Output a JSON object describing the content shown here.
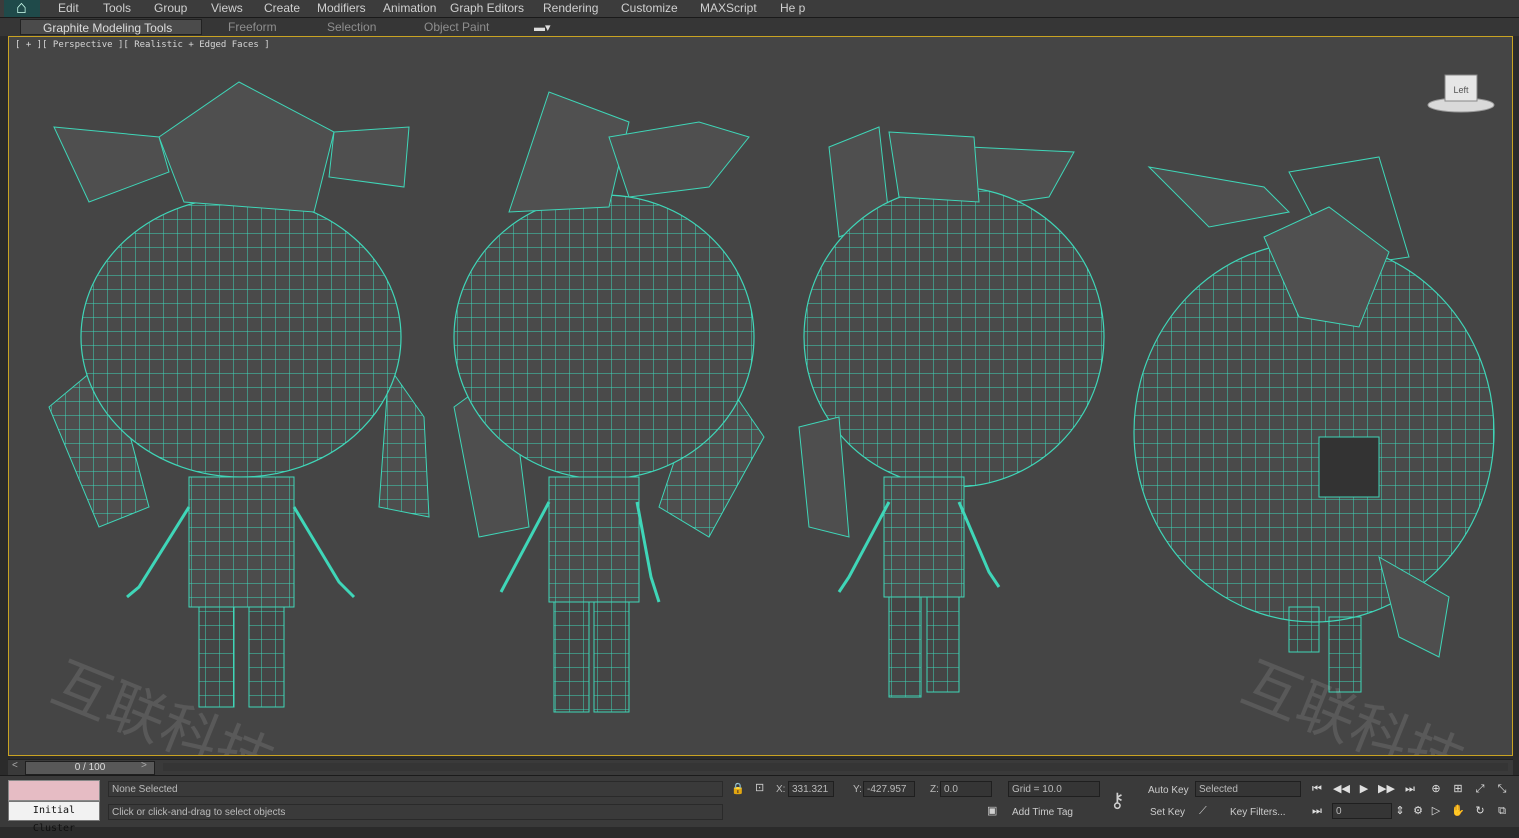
{
  "menubar": {
    "items": [
      "Edit",
      "Tools",
      "Group",
      "Views",
      "Create",
      "Modifiers",
      "Animation",
      "Graph Editors",
      "Rendering",
      "Customize",
      "MAXScript",
      "He p"
    ]
  },
  "ribbon": {
    "tabs": [
      "Graphite Modeling Tools",
      "Freeform",
      "Selection",
      "Object Paint"
    ],
    "active_tab": "Graphite Modeling Tools"
  },
  "viewport": {
    "label": "[ + ][ Perspective ][ Realistic + Edged Faces ]",
    "viewcube_text": "Left",
    "wire_color": "#3fd6b8",
    "mesh_color": "#4e4e4e",
    "watermarks": [
      "互联科技",
      "互联科技"
    ]
  },
  "timeline": {
    "prev": "<",
    "frame_readout": "0 / 100",
    "next": ">"
  },
  "status": {
    "swatch_color": "#e6bcc4",
    "cluster_label": "Initial Cluster",
    "selection_text": "None Selected",
    "prompt_text": "Click or click-and-drag to select objects",
    "x_label": "X:",
    "x_value": "331.321",
    "y_label": "Y:",
    "y_value": "-427.957",
    "z_label": "Z:",
    "z_value": "0.0",
    "grid_text": "Grid = 10.0",
    "add_time_tag": "Add Time Tag",
    "auto_key": "Auto Key",
    "set_key": "Set Key",
    "key_mode_value": "Selected",
    "key_filters": "Key Filters...",
    "current_frame": "0"
  }
}
